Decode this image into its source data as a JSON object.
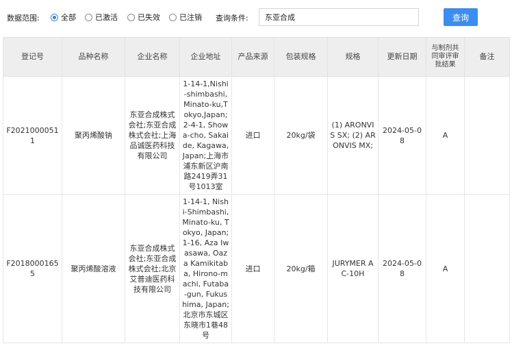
{
  "filter": {
    "scope_label": "数据范围:",
    "options": [
      {
        "label": "全部",
        "checked": true
      },
      {
        "label": "已激活",
        "checked": false
      },
      {
        "label": "已失效",
        "checked": false
      },
      {
        "label": "已注销",
        "checked": false
      }
    ],
    "query_label": "查询条件:",
    "query_value": "东亚合成",
    "query_button": "查询"
  },
  "table": {
    "headers": [
      "登记号",
      "品种名称",
      "企业名称",
      "企业地址",
      "产品来源",
      "包装规格",
      "规格",
      "更新日期",
      "与制剂共同审评审批结果",
      "备注"
    ],
    "rows": [
      {
        "reg_no": "F20210000511",
        "name": "聚丙烯酸钠",
        "company": "东亚合成株式会社;东亚合成株式会社;上海品诚医药科技有限公司",
        "address": "1-14-1,Nishi-shimbashi,Minato-ku,Tokyo,Japan;2-4-1, Showa-cho, Sakaide, Kagawa,Japan;上海市浦东新区沪南路2419弄31号1013室",
        "source": "进口",
        "package": "20kg/袋",
        "spec": "(1) ARONVIS SX; (2) ARONVIS MX;",
        "date": "2024-05-08",
        "result": "A",
        "remark": ""
      },
      {
        "reg_no": "F20180001655",
        "name": "聚丙烯酸溶液",
        "company": "东亚合成株式会社;东亚合成株式会社;北京艾普迪医药科技有限公司",
        "address": "1-14-1, Nishi-Shimbashi, Minato-ku, Tokyo, Japan; 1-16, Aza Iwasawa, Oaza Kamikitaba, Hirono-machi, Futaba-gun, Fukushima, Japan;北京市东城区东晓市1巷48号",
        "source": "进口",
        "package": "20kg/箱",
        "spec": "JURYMER AC-10H",
        "date": "2024-05-08",
        "result": "A",
        "remark": ""
      }
    ]
  },
  "colors": {
    "accent": "#3d8df0",
    "header_bg": "#eeeeee"
  }
}
